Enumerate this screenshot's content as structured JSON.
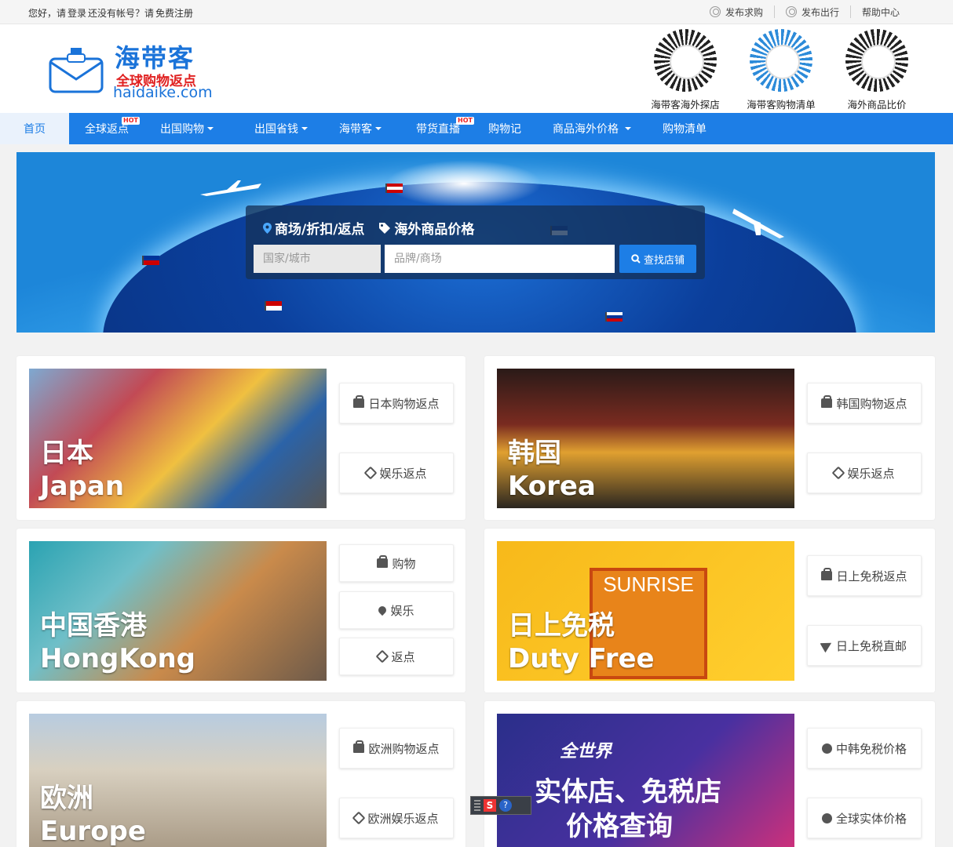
{
  "topbar": {
    "greeting": "您好，请",
    "login": "登录",
    "no_account": "还没有帐号？请",
    "register": "免费注册",
    "links": [
      "发布求购",
      "发布出行",
      "帮助中心"
    ]
  },
  "logo": {
    "cn": "海带客",
    "slogan": "全球购物返点",
    "en": "haidaike.com"
  },
  "qrcodes": [
    "海带客海外探店",
    "海带客购物清单",
    "海外商品比价"
  ],
  "nav": [
    {
      "label": "首页"
    },
    {
      "label": "全球返点",
      "badge": "HOT"
    },
    {
      "label": "出国购物"
    },
    {
      "label": "出国省钱"
    },
    {
      "label": "海带客"
    },
    {
      "label": "带货直播",
      "badge": "HOT"
    },
    {
      "label": "购物记"
    },
    {
      "label": "商品海外价格"
    },
    {
      "label": "购物清单"
    }
  ],
  "search": {
    "tab1": "商场/折扣/返点",
    "tab2": "海外商品价格",
    "city_placeholder": "国家/城市",
    "brand_placeholder": "品牌/商场",
    "button": "查找店铺"
  },
  "cards": {
    "japan": {
      "cn": "日本",
      "en": "Japan",
      "btn1": "日本购物返点",
      "btn2": "娱乐返点"
    },
    "korea": {
      "cn": "韩国",
      "en": "Korea",
      "btn1": "韩国购物返点",
      "btn2": "娱乐返点"
    },
    "hk": {
      "cn": "中国香港",
      "en": "HongKong",
      "btn1": "购物",
      "btn2": "娱乐",
      "btn3": "返点"
    },
    "duty": {
      "cn": "日上免税",
      "en": "Duty Free",
      "btn1": "日上免税返点",
      "btn2": "日上免税直邮",
      "logo": "SUNRISE"
    },
    "europe": {
      "cn": "欧洲",
      "en": "Europe",
      "btn1": "欧洲购物返点",
      "btn2": "欧洲娱乐返点"
    },
    "world": {
      "title": "全世界",
      "line1": "实体店、免税店",
      "line2": "价格查询",
      "btn1": "中韩免税价格",
      "btn2": "全球实体价格"
    }
  },
  "colors": {
    "brand_blue": "#1d7ee6",
    "logo_red": "#e02020"
  }
}
